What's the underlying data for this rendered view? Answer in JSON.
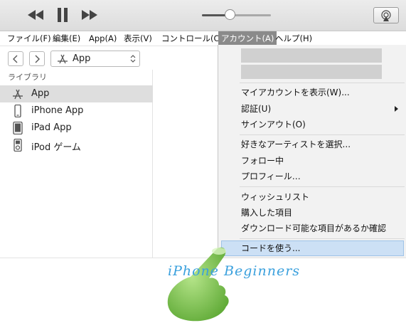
{
  "toolbar": {
    "rewind_icon": "rewind-icon",
    "pause_icon": "pause-icon",
    "forward_icon": "fast-forward-icon",
    "volume_level": 0.35,
    "airplay_icon": "airplay-icon"
  },
  "menubar": {
    "items": [
      "ファイル(F)",
      "編集(E)",
      "App(A)",
      "表示(V)",
      "コントロール(C)",
      "アカウント(A)",
      "ヘルプ(H)"
    ],
    "active": "アカウント(A)"
  },
  "nav": {
    "back_icon": "chevron-left-icon",
    "forward_icon": "chevron-right-icon",
    "selector_label": "App",
    "selector_icon": "app-store-icon"
  },
  "sidebar": {
    "heading": "ライブラリ",
    "items": [
      {
        "label": "App",
        "icon": "app-store-icon",
        "selected": true
      },
      {
        "label": "iPhone App",
        "icon": "iphone-icon",
        "selected": false
      },
      {
        "label": "iPad App",
        "icon": "ipad-icon",
        "selected": false
      },
      {
        "label": "iPod ゲーム",
        "icon": "ipod-icon",
        "selected": false
      }
    ]
  },
  "account_menu": {
    "groups": [
      [
        "マイアカウントを表示(W)...",
        "認証(U)",
        "サインアウト(O)"
      ],
      [
        "好きなアーティストを選択...",
        "フォロー中",
        "プロフィール…"
      ],
      [
        "ウィッシュリスト",
        "購入した項目",
        "ダウンロード可能な項目があるか確認"
      ],
      [
        "コードを使う..."
      ]
    ],
    "highlighted": "コードを使う..."
  },
  "watermark": "iPhone Beginners",
  "colors": {
    "highlight": "#cce0f5",
    "active_menu": "#8a8a8a",
    "watermark": "#3aa0dd",
    "hand": "#7cc84a"
  }
}
